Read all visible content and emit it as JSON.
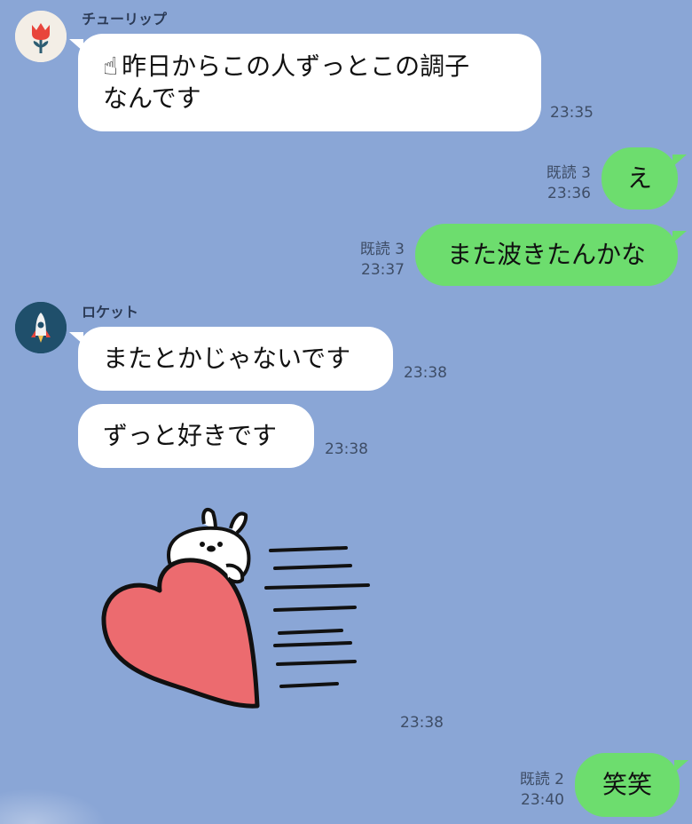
{
  "messages": [
    {
      "sender": "チューリップ",
      "avatar_icon": "tulip-icon",
      "text": "昨日からこの人ずっとこの調子",
      "text_line2": "なんです",
      "emoji": "☝",
      "time": "23:35"
    },
    {
      "text": "え",
      "read": "既読 3",
      "time": "23:36"
    },
    {
      "text": "また波きたんかな",
      "read": "既読 3",
      "time": "23:37"
    },
    {
      "sender": "ロケット",
      "avatar_icon": "rocket-icon",
      "text": "またとかじゃないです",
      "time": "23:38"
    },
    {
      "text": "ずっと好きです",
      "time": "23:38"
    },
    {
      "sticker": "rabbit-heart-sticker",
      "time": "23:38"
    },
    {
      "text": "笑笑",
      "read": "既読 2",
      "time": "23:40"
    }
  ],
  "colors": {
    "background": "#8aa6d6",
    "incoming_bubble": "#ffffff",
    "outgoing_bubble": "#6ddd6e"
  }
}
